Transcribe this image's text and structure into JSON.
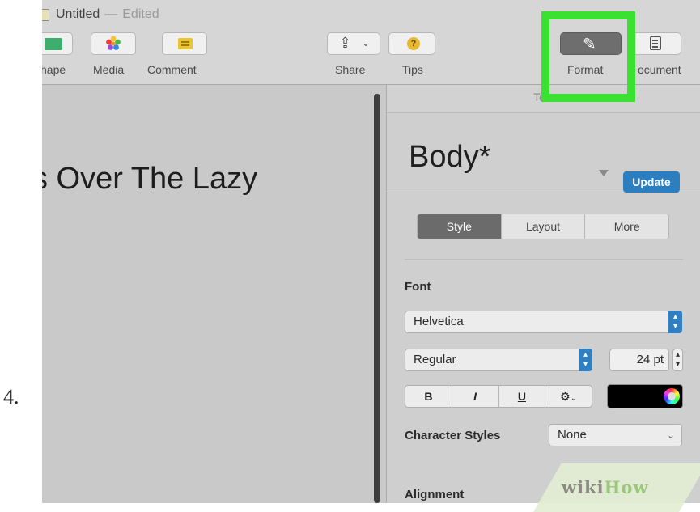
{
  "step": {
    "number": "4."
  },
  "window": {
    "title": "Untitled",
    "separator": "—",
    "status": "Edited"
  },
  "toolbar": {
    "buttons": [
      {
        "label": "hape",
        "icon": "shape-icon"
      },
      {
        "label": "Media",
        "icon": "media-icon"
      },
      {
        "label": "Comment",
        "icon": "comment-icon"
      },
      {
        "label": "Share",
        "icon": "share-icon"
      },
      {
        "label": "Tips",
        "icon": "tips-icon",
        "glyph": "?"
      },
      {
        "label": "Format",
        "icon": "paintbrush-icon",
        "selected": true
      },
      {
        "label": "ocument",
        "icon": "document-icon"
      }
    ]
  },
  "document": {
    "visible_text": "s Over The Lazy"
  },
  "inspector": {
    "header": "Text",
    "paragraph_style": "Body*",
    "update_label": "Update",
    "tabs": [
      {
        "label": "Style",
        "active": true
      },
      {
        "label": "Layout",
        "active": false
      },
      {
        "label": "More",
        "active": false
      }
    ],
    "font_label": "Font",
    "font_family": "Helvetica",
    "typeface": "Regular",
    "font_size": "24 pt",
    "format_buttons": [
      "B",
      "I",
      "U"
    ],
    "text_color": "#000000",
    "character_styles_label": "Character Styles",
    "character_style_value": "None",
    "alignment_label": "Alignment"
  },
  "highlight_color": "#3be130",
  "accent_color": "#2b7ec0",
  "watermark": {
    "part1": "wiki",
    "part2": "How"
  }
}
